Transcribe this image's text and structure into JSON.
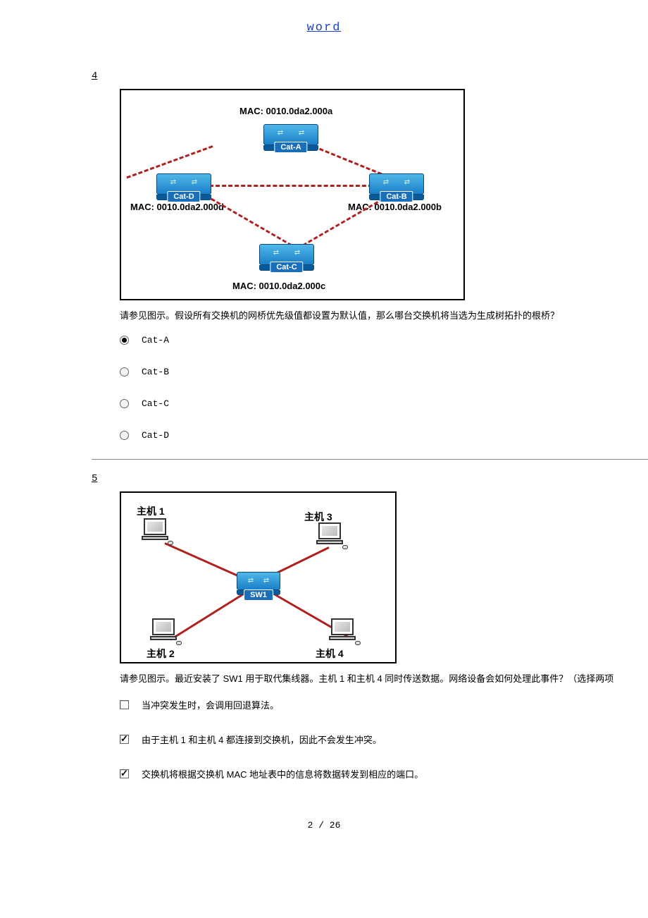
{
  "header": {
    "word": "word"
  },
  "q4": {
    "number": "4",
    "diagram": {
      "labels": {
        "top_mac": "MAC: 0010.0da2.000a",
        "right_mac": "MAC: 0010.0da2.000b",
        "bottom_mac": "MAC: 0010.0da2.000c",
        "left_mac": "MAC: 0010.0da2.000d",
        "cat_a": "Cat-A",
        "cat_b": "Cat-B",
        "cat_c": "Cat-C",
        "cat_d": "Cat-D"
      }
    },
    "question_text": "请参见图示。假设所有交换机的网桥优先级值都设置为默认值，那么哪台交换机将当选为生成树拓扑的根桥？",
    "options": [
      {
        "label": "Cat-A",
        "selected": true
      },
      {
        "label": "Cat-B",
        "selected": false
      },
      {
        "label": "Cat-C",
        "selected": false
      },
      {
        "label": "Cat-D",
        "selected": false
      }
    ]
  },
  "q5": {
    "number": "5",
    "diagram": {
      "labels": {
        "host1": "主机 1",
        "host2": "主机 2",
        "host3": "主机 3",
        "host4": "主机 4",
        "sw1": "SW1"
      }
    },
    "question_text": "请参见图示。最近安装了 SW1 用于取代集线器。主机 1 和主机 4 同时传送数据。网络设备会如何处理此事件？（选择两项",
    "options": [
      {
        "label": "当冲突发生时，会调用回退算法。",
        "selected": false
      },
      {
        "label": "由于主机 1 和主机 4 都连接到交换机，因此不会发生冲突。",
        "selected": true
      },
      {
        "label": "交换机将根据交换机 MAC 地址表中的信息将数据转发到相应的端口。",
        "selected": true
      }
    ]
  },
  "footer": {
    "page": "2 / 26"
  }
}
